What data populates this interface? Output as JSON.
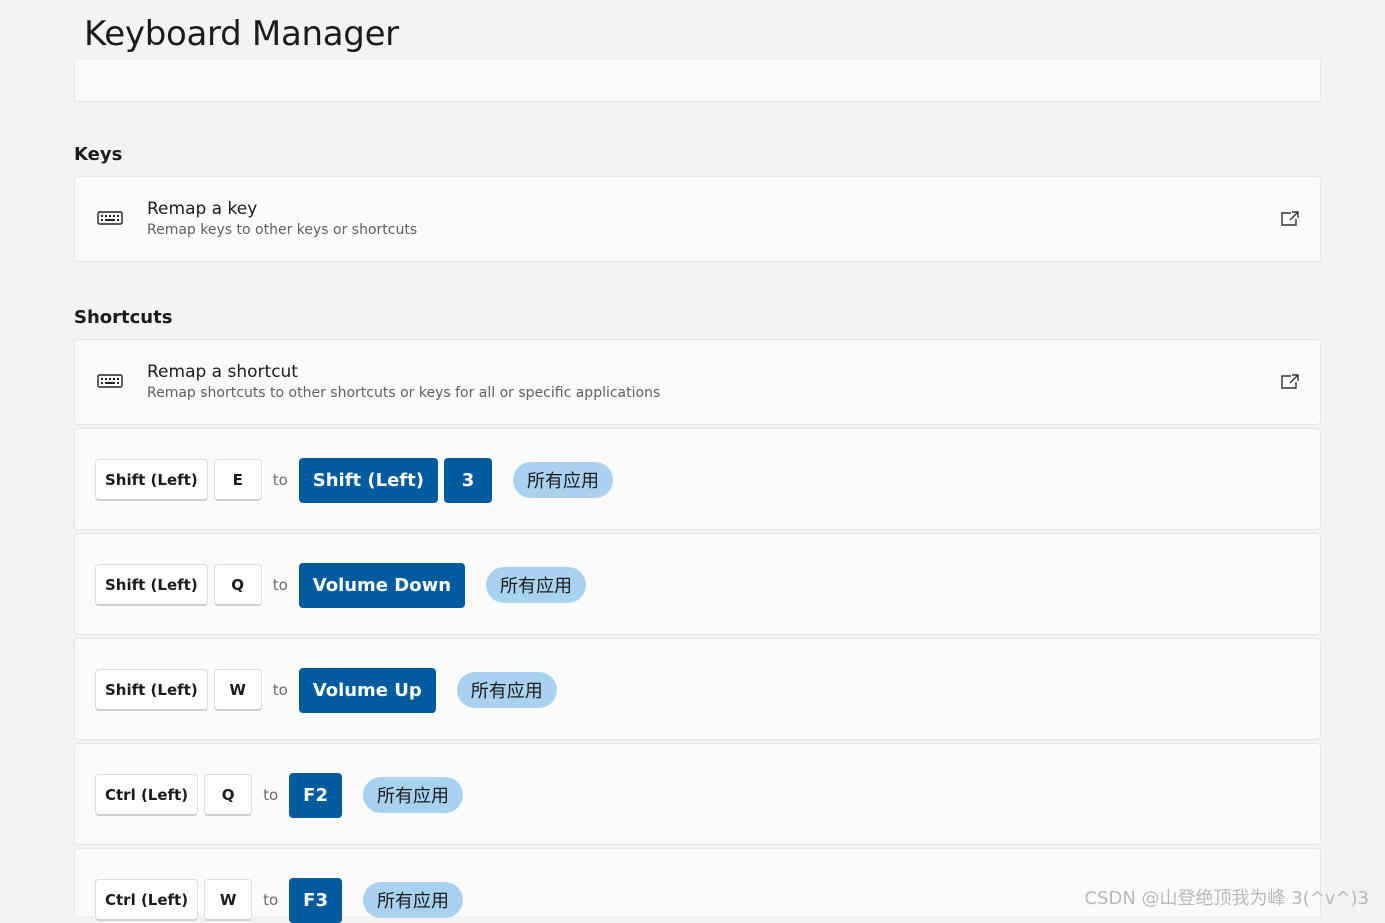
{
  "page": {
    "title": "Keyboard Manager"
  },
  "keys_section": {
    "title": "Keys",
    "card": {
      "icon": "keyboard-icon",
      "title": "Remap a key",
      "description": "Remap keys to other keys or shortcuts",
      "action_icon": "open-external-icon"
    }
  },
  "shortcuts_section": {
    "title": "Shortcuts",
    "card": {
      "icon": "keyboard-icon",
      "title": "Remap a shortcut",
      "description": "Remap shortcuts to other shortcuts or keys for all or specific applications",
      "action_icon": "open-external-icon"
    },
    "connector": "to",
    "mappings": [
      {
        "from": [
          "Shift (Left)",
          "E"
        ],
        "to": [
          "Shift (Left)",
          "3"
        ],
        "app": "所有应用"
      },
      {
        "from": [
          "Shift (Left)",
          "Q"
        ],
        "to": [
          "Volume Down"
        ],
        "app": "所有应用"
      },
      {
        "from": [
          "Shift (Left)",
          "W"
        ],
        "to": [
          "Volume Up"
        ],
        "app": "所有应用"
      },
      {
        "from": [
          "Ctrl (Left)",
          "Q"
        ],
        "to": [
          "F2"
        ],
        "app": "所有应用"
      },
      {
        "from": [
          "Ctrl (Left)",
          "W"
        ],
        "to": [
          "F3"
        ],
        "app": "所有应用"
      }
    ]
  },
  "watermark": "CSDN @山登绝顶我为峰 3(^v^)3",
  "colors": {
    "background": "#f3f3f3",
    "card": "#fbfbfb",
    "accent": "#005a9e",
    "app_pill": "#a9d1f0"
  }
}
